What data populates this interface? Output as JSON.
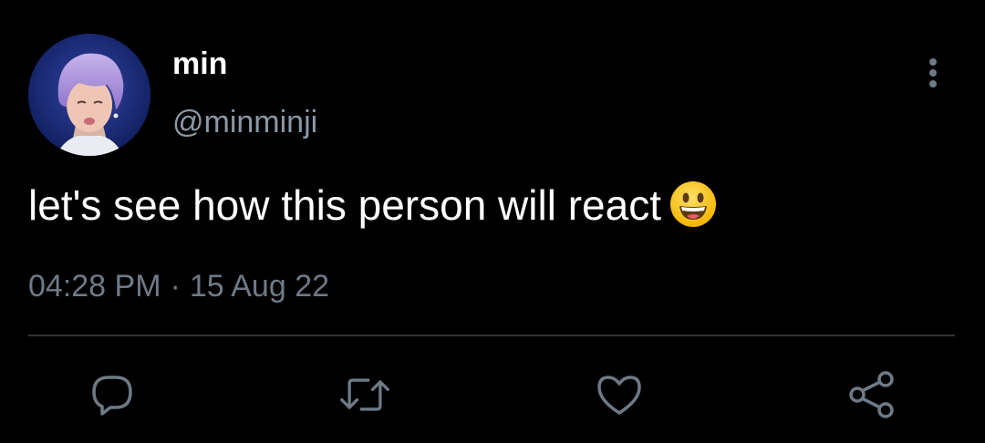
{
  "tweet": {
    "author": {
      "display_name": "min",
      "handle": "@minminji",
      "avatar": "avatar-photo"
    },
    "text": "let's see how this person will react",
    "emoji": "grinning-face-emoji",
    "time": "04:28 PM",
    "separator": "·",
    "date": "15 Aug 22"
  },
  "actions": [
    {
      "name": "reply",
      "icon": "comment-icon"
    },
    {
      "name": "retweet",
      "icon": "retweet-icon"
    },
    {
      "name": "like",
      "icon": "heart-icon"
    },
    {
      "name": "share",
      "icon": "share-icon"
    }
  ],
  "menu": {
    "icon": "more-vertical-icon"
  },
  "colors": {
    "background": "#000000",
    "primary_text": "#ffffff",
    "secondary_text": "#8b98a5",
    "icon": "#6e7a86",
    "divider": "#2f3336"
  }
}
